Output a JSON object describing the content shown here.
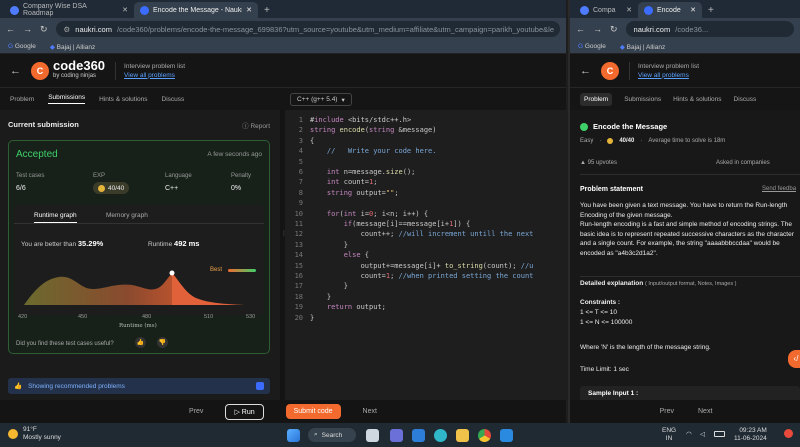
{
  "left": {
    "tabs": [
      {
        "title": "Company Wise DSA Roadmap",
        "color": "#4f7cff"
      },
      {
        "title": "Encode the Message - Naukri C",
        "color": "#3b6cff"
      }
    ],
    "new_tab": "+",
    "url_host": "naukri.com",
    "url_rest": "/code360/problems/encode-the-message_699836?utm_source=youtube&utm_medium=affiliate&utm_campaign=parikh_youtube&le",
    "bookmarks": [
      "Google",
      "Bajaj | Allianz"
    ],
    "logo_main": "code360",
    "logo_sub": "by coding ninjas",
    "ipl_title": "Interview problem list",
    "ipl_link": "View all problems",
    "subtabs": [
      "Problem",
      "Submissions",
      "Hints & solutions",
      "Discuss"
    ],
    "lang_select": "C++ (g++ 5.4)",
    "current_submission": "Current submission",
    "report": "Report",
    "status": "Accepted",
    "when": "A few seconds ago",
    "stats": [
      {
        "label": "Test cases",
        "value": "6/6"
      },
      {
        "label": "EXP",
        "value": "40/40"
      },
      {
        "label": "Language",
        "value": "C++"
      },
      {
        "label": "Penalty",
        "value": "0%"
      }
    ],
    "graph_tabs": [
      "Runtime graph",
      "Memory graph"
    ],
    "better_label": "You are better than",
    "better_value": "35.29%",
    "runtime_label": "Runtime",
    "runtime_value": "492 ms",
    "best_label": "Best",
    "x_ticks": [
      "420",
      "450",
      "480",
      "510",
      "530"
    ],
    "x_axis_label": "Runtime (ms)",
    "useful_q": "Did you find these test cases useful?",
    "showing_rec": "Showing recommended problems",
    "bottom": {
      "prev": "Prev",
      "run": "Run",
      "submit": "Submit code",
      "next": "Next"
    }
  },
  "code_lines": [
    "#include <bits/stdc++.h>",
    "string encode(string &message)",
    "{",
    "    //   Write your code here.",
    "",
    "    int n=message.size();",
    "    int count=1;",
    "    string output=\"\";",
    "",
    "    for(int i=0; i<n; i++) {",
    "        if(message[i]==message[i+1]) {",
    "            count++; //will increment untill the next",
    "        }",
    "        else {",
    "            output+=message[i]+ to_string(count); //u",
    "            count=1; //when printed setting the count",
    "        }",
    "    }",
    "    return output;",
    "}"
  ],
  "right": {
    "tabs": [
      {
        "title": "Compa",
        "color": "#4f7cff"
      },
      {
        "title": "Encode",
        "color": "#3b6cff"
      }
    ],
    "new_tab": "+",
    "url_host": "naukri.com",
    "url_rest": "/code36...",
    "bookmarks": [
      "Google",
      "Bajaj | Allianz"
    ],
    "ipl_title": "Interview problem list",
    "ipl_link": "View all problems",
    "subtabs": [
      "Problem",
      "Submissions",
      "Hints & solutions",
      "Discuss"
    ],
    "problem_title": "Encode the Message",
    "difficulty": "Easy",
    "exp": "40/40",
    "avg_time": "Average time to solve is 18m",
    "upvotes": "95 upvotes",
    "asked_in": "Asked in companies",
    "ps_heading": "Problem statement",
    "send_feedback": "Send feedba",
    "statement": "You have been given a text message. You have to return the Run-length Encoding of the given message.",
    "statement2": "Run-length encoding is a fast and simple method of encoding strings. The basic idea is to represent repeated successive characters as the character and a single count. For example, the string \"aaaabbbccdaa\" would be encoded as \"a4b3c2d1a2\".",
    "detailed": "Detailed explanation",
    "detailed_sub": "( Input/output format, Notes, Images )",
    "constraints": "Constraints :",
    "c1": "1 <= T <= 10",
    "c2": "1 <= N <= 100000",
    "where": "Where 'N' is the length of the message string.",
    "time_limit": "Time Limit: 1 sec",
    "sample": "Sample Input 1 :",
    "prev": "Prev",
    "next": "Next"
  },
  "taskbar": {
    "weather_temp": "91°F",
    "weather_desc": "Mostly sunny",
    "search": "Search",
    "lang1": "ENG",
    "lang2": "IN",
    "time": "09:23 AM",
    "date": "11-06-2024"
  }
}
